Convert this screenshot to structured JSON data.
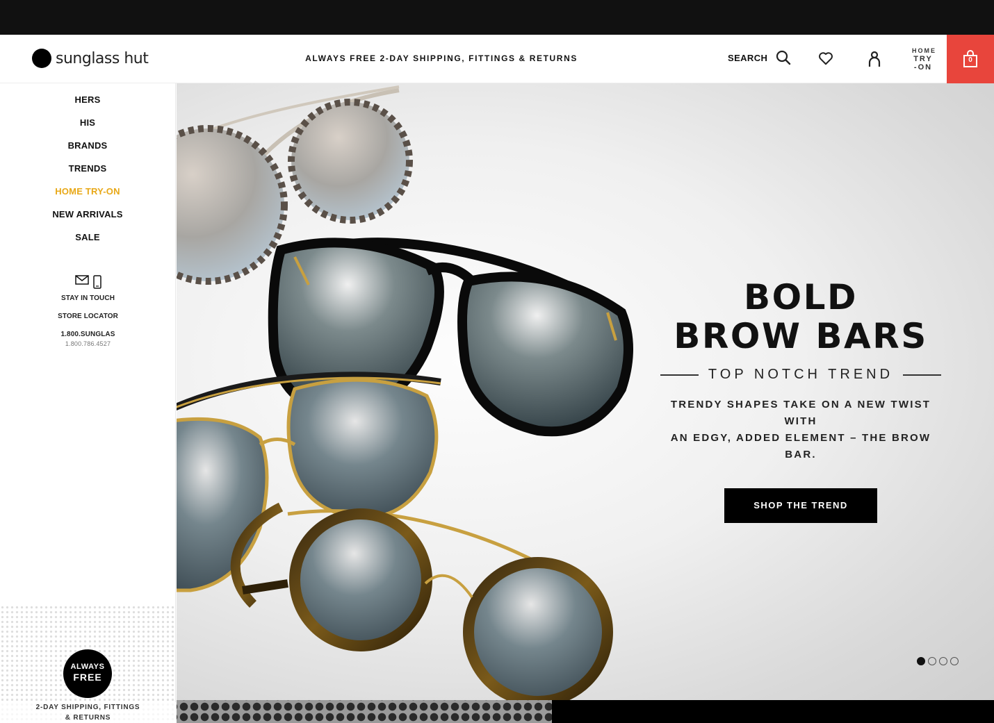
{
  "header": {
    "brand": "sunglass hut",
    "promo": "ALWAYS FREE 2-DAY SHIPPING, FITTINGS & RETURNS",
    "search_label": "SEARCH",
    "home_try_on": [
      "HOME",
      "TRY",
      "-ON"
    ],
    "cart_count": "0"
  },
  "sidebar": {
    "nav": [
      {
        "label": "HERS"
      },
      {
        "label": "HIS"
      },
      {
        "label": "BRANDS"
      },
      {
        "label": "TRENDS"
      },
      {
        "label": "HOME TRY-ON",
        "active": true
      },
      {
        "label": "NEW ARRIVALS"
      },
      {
        "label": "SALE"
      }
    ],
    "stay_in_touch": "STAY IN TOUCH",
    "store_locator": "STORE LOCATOR",
    "phone_label": "1.800.SUNGLAS",
    "phone_number": "1.800.786.4527",
    "badge_line1": "ALWAYS",
    "badge_line2": "FREE",
    "shipping_note_line1": "2-DAY SHIPPING, FITTINGS",
    "shipping_note_line2": "& RETURNS"
  },
  "hero": {
    "headline_line1": "BOLD",
    "headline_line2": "BROW BARS",
    "subheadline": "TOP NOTCH TREND",
    "description_line1": "TRENDY SHAPES TAKE ON A NEW TWIST WITH",
    "description_line2": "AN EDGY, ADDED ELEMENT – THE BROW BAR.",
    "cta": "SHOP THE TREND",
    "slide_count": 4,
    "active_slide": 1
  },
  "colors": {
    "accent_red": "#e8453c",
    "active_nav": "#e8a817",
    "topbar": "#111111"
  }
}
